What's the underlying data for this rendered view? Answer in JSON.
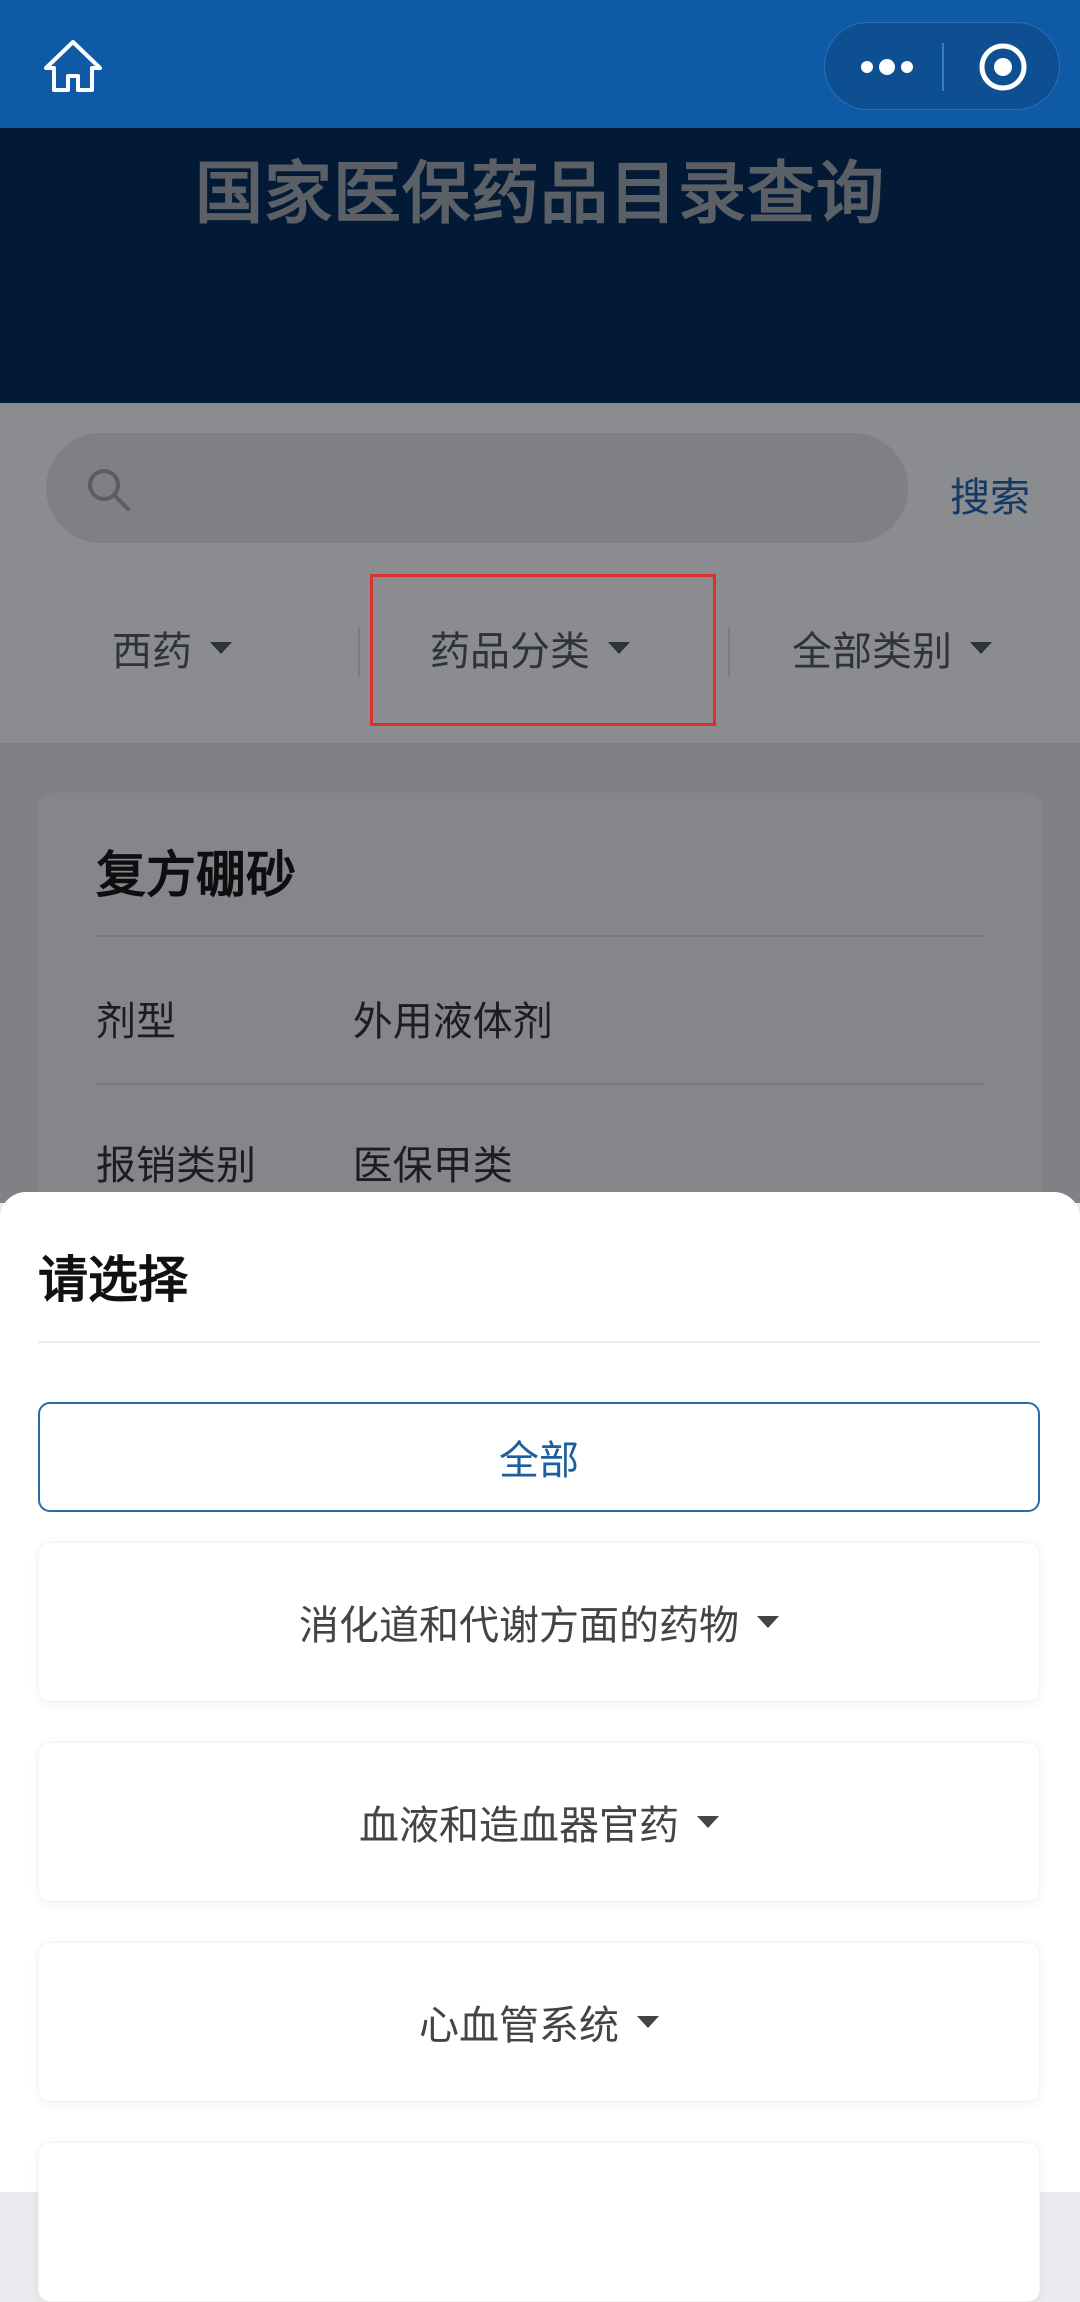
{
  "header": {
    "home_icon": "home-icon",
    "more_icon": "more-dots-icon",
    "target_icon": "target-circle-icon"
  },
  "banner": {
    "title": "国家医保药品目录查询"
  },
  "search": {
    "placeholder": "",
    "button_label": "搜索"
  },
  "filters": [
    {
      "label": "西药"
    },
    {
      "label": "药品分类"
    },
    {
      "label": "全部类别"
    }
  ],
  "drug_card": {
    "name": "复方硼砂",
    "rows": [
      {
        "label": "剂型",
        "value": "外用液体剂"
      },
      {
        "label": "报销类别",
        "value": "医保甲类"
      }
    ]
  },
  "sheet": {
    "title": "请选择",
    "options": [
      {
        "label": "全部",
        "selected": true
      },
      {
        "label": "消化道和代谢方面的药物"
      },
      {
        "label": "血液和造血器官药"
      },
      {
        "label": "心血管系统"
      },
      {
        "label": ""
      }
    ]
  },
  "colors": {
    "header_bg": "#0f5aa6",
    "banner_bg": "#031a36",
    "accent": "#1c5f9e",
    "highlight_box": "#d9312b"
  }
}
